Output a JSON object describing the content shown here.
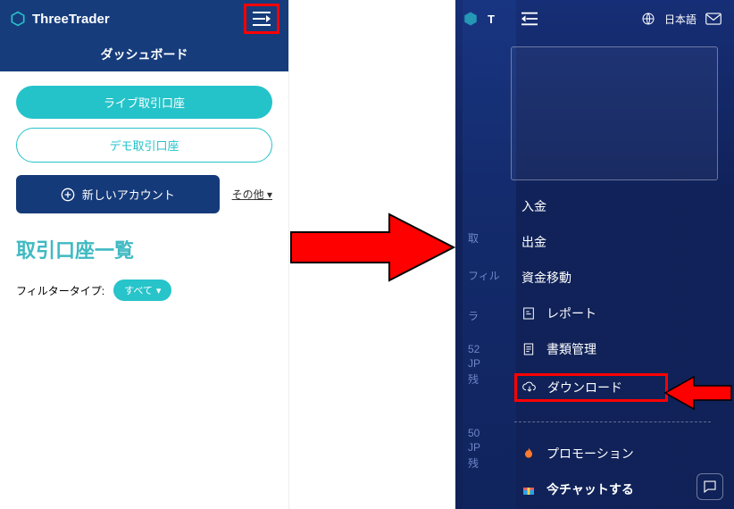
{
  "left": {
    "brand": "ThreeTrader",
    "title": "ダッシュボード",
    "live_btn": "ライブ取引口座",
    "demo_btn": "デモ取引口座",
    "new_account": "新しいアカウント",
    "other": "その他",
    "section_heading": "取引口座一覧",
    "filter_label": "フィルタータイプ:",
    "filter_chip": "すべて"
  },
  "right": {
    "brand_partial": "T",
    "lang": "日本語",
    "menu": {
      "deposit": "入金",
      "withdraw": "出金",
      "transfer": "資金移動",
      "report": "レポート",
      "documents": "書類管理",
      "download": "ダウンロード",
      "promotion": "プロモーション",
      "chat_now": "今チャットする"
    },
    "faint": {
      "t1": "取",
      "t2": "フィル",
      "t3": "ラ",
      "t4": "52",
      "t5": "JP",
      "t6": "残",
      "t7": "50",
      "t8": "JP",
      "t9": "残"
    }
  }
}
